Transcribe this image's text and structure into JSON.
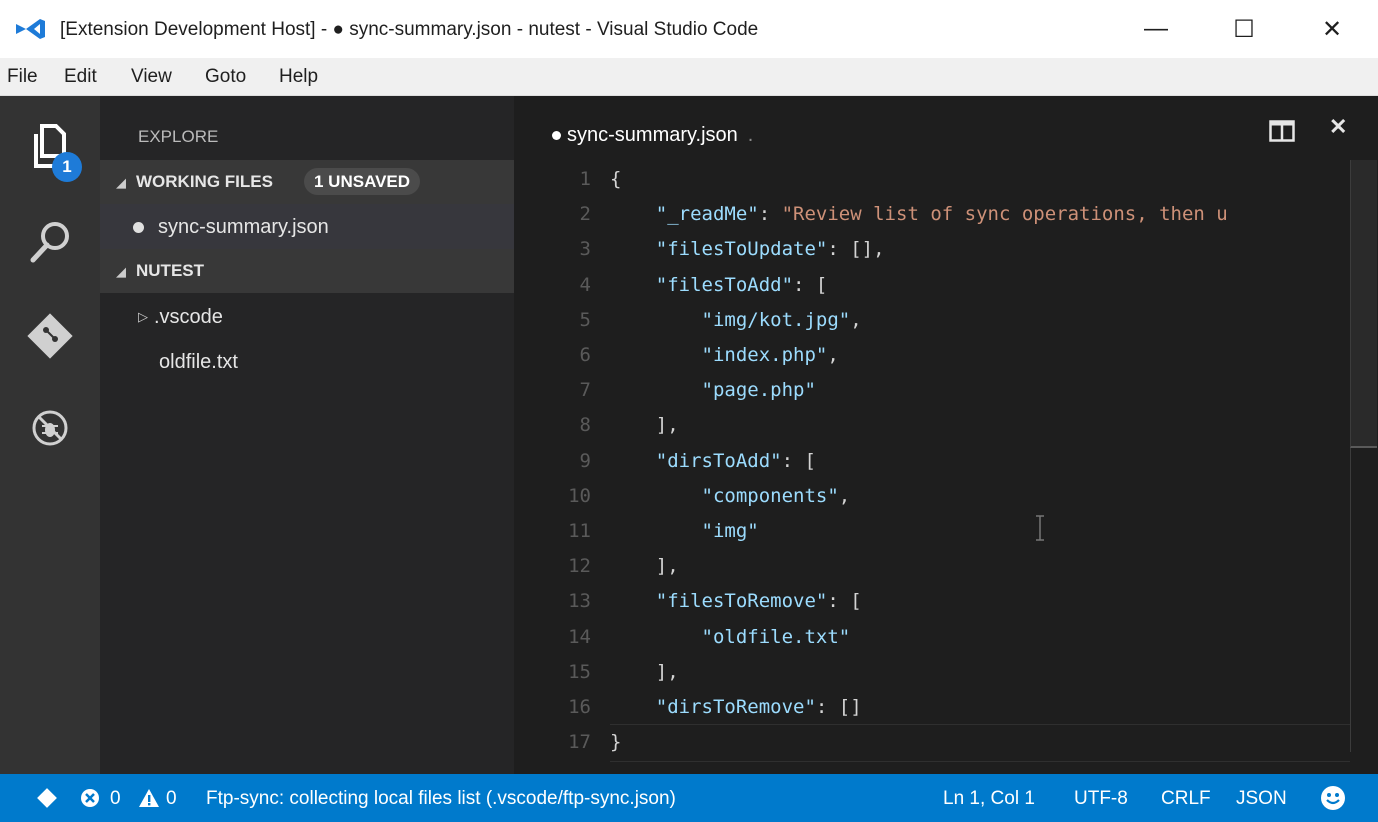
{
  "window": {
    "title": "[Extension Development Host] - ● sync-summary.json - nutest - Visual Studio Code",
    "minimize_glyph": "—",
    "maximize_glyph": "☐",
    "close_glyph": "✕"
  },
  "menu": [
    "File",
    "Edit",
    "View",
    "Goto",
    "Help"
  ],
  "activity_bar": {
    "items": [
      "explorer-icon",
      "search-icon",
      "git-icon",
      "debug-icon"
    ],
    "explorer_badge": "1"
  },
  "sidebar": {
    "heading": "EXPLORE",
    "working_files": {
      "label": "WORKING FILES",
      "badge": "1 UNSAVED",
      "items": [
        "sync-summary.json"
      ]
    },
    "project": {
      "label": "NUTEST",
      "folder": ".vscode",
      "file": "oldfile.txt"
    },
    "arrow_glyph": "◢",
    "folder_arrow_glyph": "▷"
  },
  "editor": {
    "tab": {
      "name": "sync-summary.json",
      "suffix": "."
    },
    "close_glyph": "✕",
    "lines": [
      {
        "n": "1",
        "parts": [
          {
            "t": "{",
            "c": "p"
          }
        ]
      },
      {
        "n": "2",
        "parts": [
          {
            "t": "    ",
            "c": "p"
          },
          {
            "t": "\"_readMe\"",
            "c": "k"
          },
          {
            "t": ": ",
            "c": "p"
          },
          {
            "t": "\"Review list of sync operations, then u",
            "c": "s"
          }
        ]
      },
      {
        "n": "3",
        "parts": [
          {
            "t": "    ",
            "c": "p"
          },
          {
            "t": "\"filesToUpdate\"",
            "c": "k"
          },
          {
            "t": ": [],",
            "c": "p"
          }
        ]
      },
      {
        "n": "4",
        "parts": [
          {
            "t": "    ",
            "c": "p"
          },
          {
            "t": "\"filesToAdd\"",
            "c": "k"
          },
          {
            "t": ": [",
            "c": "p"
          }
        ]
      },
      {
        "n": "5",
        "parts": [
          {
            "t": "        ",
            "c": "p"
          },
          {
            "t": "\"img/kot.jpg\"",
            "c": "k"
          },
          {
            "t": ",",
            "c": "p"
          }
        ]
      },
      {
        "n": "6",
        "parts": [
          {
            "t": "        ",
            "c": "p"
          },
          {
            "t": "\"index.php\"",
            "c": "k"
          },
          {
            "t": ",",
            "c": "p"
          }
        ]
      },
      {
        "n": "7",
        "parts": [
          {
            "t": "        ",
            "c": "p"
          },
          {
            "t": "\"page.php\"",
            "c": "k"
          }
        ]
      },
      {
        "n": "8",
        "parts": [
          {
            "t": "    ],",
            "c": "p"
          }
        ]
      },
      {
        "n": "9",
        "parts": [
          {
            "t": "    ",
            "c": "p"
          },
          {
            "t": "\"dirsToAdd\"",
            "c": "k"
          },
          {
            "t": ": [",
            "c": "p"
          }
        ]
      },
      {
        "n": "10",
        "parts": [
          {
            "t": "        ",
            "c": "p"
          },
          {
            "t": "\"components\"",
            "c": "k"
          },
          {
            "t": ",",
            "c": "p"
          }
        ]
      },
      {
        "n": "11",
        "parts": [
          {
            "t": "        ",
            "c": "p"
          },
          {
            "t": "\"img\"",
            "c": "k"
          }
        ]
      },
      {
        "n": "12",
        "parts": [
          {
            "t": "    ],",
            "c": "p"
          }
        ]
      },
      {
        "n": "13",
        "parts": [
          {
            "t": "    ",
            "c": "p"
          },
          {
            "t": "\"filesToRemove\"",
            "c": "k"
          },
          {
            "t": ": [",
            "c": "p"
          }
        ]
      },
      {
        "n": "14",
        "parts": [
          {
            "t": "        ",
            "c": "p"
          },
          {
            "t": "\"oldfile.txt\"",
            "c": "k"
          }
        ]
      },
      {
        "n": "15",
        "parts": [
          {
            "t": "    ],",
            "c": "p"
          }
        ]
      },
      {
        "n": "16",
        "parts": [
          {
            "t": "    ",
            "c": "p"
          },
          {
            "t": "\"dirsToRemove\"",
            "c": "k"
          },
          {
            "t": ": []",
            "c": "p"
          }
        ]
      },
      {
        "n": "17",
        "parts": [
          {
            "t": "}",
            "c": "p"
          }
        ]
      }
    ]
  },
  "status": {
    "errors": "0",
    "warnings": "0",
    "message": "Ftp-sync: collecting local files list (.vscode/ftp-sync.json)",
    "position": "Ln 1, Col 1",
    "encoding": "UTF-8",
    "eol": "CRLF",
    "language": "JSON"
  },
  "colors": {
    "accent": "#007acc",
    "badge": "#1e7bd8",
    "key": "#9cdcfe",
    "string": "#ce9178"
  }
}
